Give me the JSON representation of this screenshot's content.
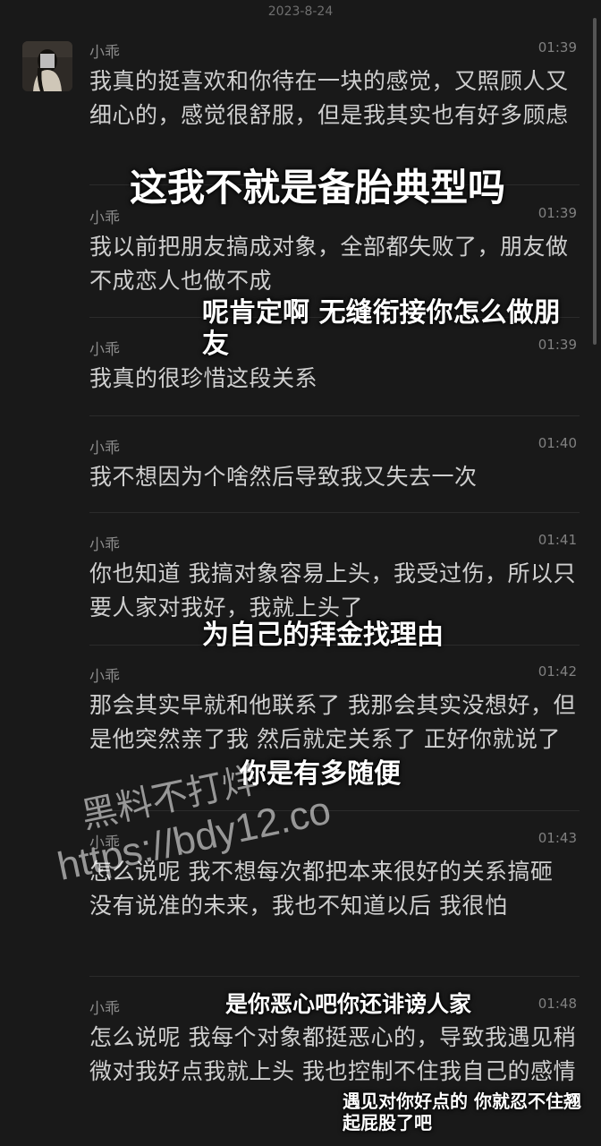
{
  "date": "2023-8-24",
  "messages": [
    {
      "sender": "小乖",
      "time": "01:39",
      "text": "我真的挺喜欢和你待在一块的感觉，又照顾人又细心的，感觉很舒服，但是我其实也有好多顾虑"
    },
    {
      "sender": "小乖",
      "time": "01:39",
      "text": "我以前把朋友搞成对象，全部都失败了，朋友做不成恋人也做不成"
    },
    {
      "sender": "小乖",
      "time": "01:39",
      "text": "我真的很珍惜这段关系"
    },
    {
      "sender": "小乖",
      "time": "01:40",
      "text": "我不想因为个啥然后导致我又失去一次"
    },
    {
      "sender": "小乖",
      "time": "01:41",
      "text": "你也知道 我搞对象容易上头，我受过伤，所以只要人家对我好，我就上头了"
    },
    {
      "sender": "小乖",
      "time": "01:42",
      "text": "那会其实早就和他联系了 我那会其实没想好，但是他突然亲了我 然后就定关系了 正好你就说了"
    },
    {
      "sender": "小乖",
      "time": "01:43",
      "text": "怎么说呢  我不想每次都把本来很好的关系搞砸 没有说准的未来，我也不知道以后 我很怕"
    },
    {
      "sender": "小乖",
      "time": "01:48",
      "text": "怎么说呢  我每个对象都挺恶心的，导致我遇见稍微对我好点我就上头 我也控制不住我自己的感情"
    }
  ],
  "annotations": {
    "a1": "这我不就是备胎典型吗",
    "a2": "呢肯定啊 无缝衔接你怎么做朋友",
    "a3": "为自己的拜金找理由",
    "a4": "你是有多随便",
    "a5": "是你恶心吧你还诽谤人家",
    "a6": "遇见对你好点的 你就忍不住翘起屁股了吧"
  },
  "watermark": {
    "line1": "黑料不打烊",
    "line2": "https://bdy12.co"
  }
}
